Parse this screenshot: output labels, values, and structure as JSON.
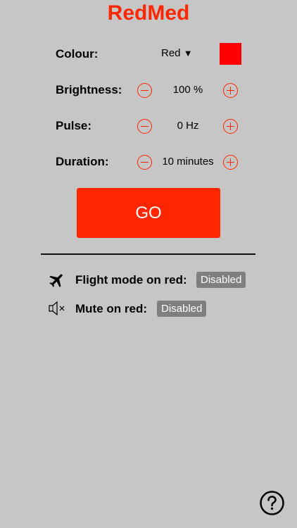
{
  "app": {
    "title": "RedMed"
  },
  "settings": {
    "colour": {
      "label": "Colour:",
      "value": "Red",
      "arrow": "▼",
      "swatch_color": "#ff0000"
    },
    "brightness": {
      "label": "Brightness:",
      "value": "100 %"
    },
    "pulse": {
      "label": "Pulse:",
      "value": "0 Hz"
    },
    "duration": {
      "label": "Duration:",
      "value": "10 minutes"
    }
  },
  "go_button": {
    "label": "GO"
  },
  "options": {
    "flight_mode": {
      "label": "Flight mode on red:",
      "status": "Disabled"
    },
    "mute": {
      "label": "Mute on red:",
      "status": "Disabled"
    }
  },
  "help": {
    "icon": "question-circle-icon"
  },
  "colors": {
    "accent": "#ff2600",
    "background": "#c6c6c6",
    "badge": "#7f7f7f"
  }
}
